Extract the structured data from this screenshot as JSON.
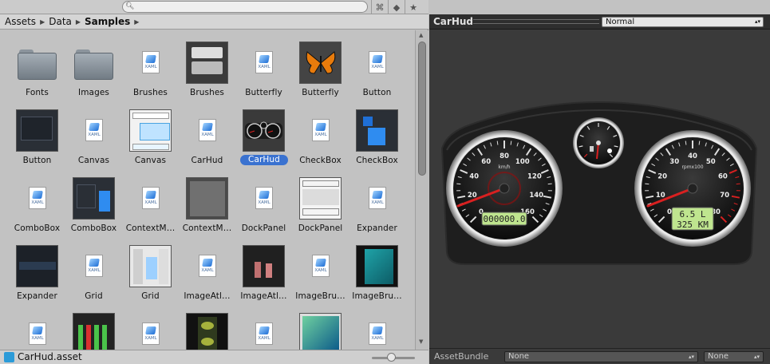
{
  "toolbar": {
    "search_placeholder": "",
    "icons": [
      "search-icon",
      "filter-icon",
      "label-icon",
      "star-icon"
    ]
  },
  "breadcrumb": [
    "Assets",
    "Data",
    "Samples"
  ],
  "grid": [
    {
      "label": "Fonts",
      "kind": "folder"
    },
    {
      "label": "Images",
      "kind": "folder"
    },
    {
      "label": "Brushes",
      "kind": "xaml"
    },
    {
      "label": "Brushes",
      "kind": "image",
      "thumb": "brushes"
    },
    {
      "label": "Butterfly",
      "kind": "xaml"
    },
    {
      "label": "Butterfly",
      "kind": "image",
      "thumb": "butterfly"
    },
    {
      "label": "Button",
      "kind": "xaml"
    },
    {
      "label": "Button",
      "kind": "image",
      "thumb": "button"
    },
    {
      "label": "Canvas",
      "kind": "xaml"
    },
    {
      "label": "Canvas",
      "kind": "image",
      "thumb": "canvas"
    },
    {
      "label": "CarHud",
      "kind": "xaml"
    },
    {
      "label": "CarHud",
      "kind": "image",
      "thumb": "carhud",
      "selected": true
    },
    {
      "label": "CheckBox",
      "kind": "xaml"
    },
    {
      "label": "CheckBox",
      "kind": "image",
      "thumb": "checkbox"
    },
    {
      "label": "ComboBox",
      "kind": "xaml"
    },
    {
      "label": "ComboBox",
      "kind": "image",
      "thumb": "combobox"
    },
    {
      "label": "ContextM…",
      "kind": "xaml"
    },
    {
      "label": "ContextM…",
      "kind": "image",
      "thumb": "contextmenu"
    },
    {
      "label": "DockPanel",
      "kind": "xaml"
    },
    {
      "label": "DockPanel",
      "kind": "image",
      "thumb": "dockpanel"
    },
    {
      "label": "Expander",
      "kind": "xaml"
    },
    {
      "label": "Expander",
      "kind": "image",
      "thumb": "expander"
    },
    {
      "label": "Grid",
      "kind": "xaml"
    },
    {
      "label": "Grid",
      "kind": "image",
      "thumb": "grid"
    },
    {
      "label": "ImageAtl…",
      "kind": "xaml"
    },
    {
      "label": "ImageAtl…",
      "kind": "image",
      "thumb": "imageatlas"
    },
    {
      "label": "ImageBru…",
      "kind": "xaml"
    },
    {
      "label": "ImageBru…",
      "kind": "image",
      "thumb": "imagebrush"
    },
    {
      "label": "",
      "kind": "xaml"
    },
    {
      "label": "",
      "kind": "image",
      "thumb": "bars"
    },
    {
      "label": "",
      "kind": "xaml"
    },
    {
      "label": "",
      "kind": "image",
      "thumb": "film"
    },
    {
      "label": "",
      "kind": "xaml"
    },
    {
      "label": "",
      "kind": "image",
      "thumb": "teal"
    },
    {
      "label": "",
      "kind": "xaml"
    }
  ],
  "xaml_text": "XAML",
  "selected_file": "CarHud.asset",
  "zoom_fraction": 0.45,
  "preview": {
    "title": "CarHud",
    "mode": "Normal",
    "speed_ticks": [
      "0",
      "20",
      "40",
      "60",
      "80",
      "100",
      "120",
      "140",
      "160"
    ],
    "speed_unit": "km/h",
    "rpm_ticks": [
      "0",
      "10",
      "20",
      "30",
      "40",
      "50",
      "60",
      "70",
      "80"
    ],
    "rpm_unit": "rpmx100",
    "odometer": "000000.0",
    "fuel": "6.5 L",
    "range": "325 KM"
  },
  "asset_bundle": {
    "label": "AssetBundle",
    "name": "None",
    "variant": "None"
  },
  "colors": {
    "selection": "#3a72d0",
    "needle": "#d92020",
    "lcd": "#bfe58f"
  }
}
